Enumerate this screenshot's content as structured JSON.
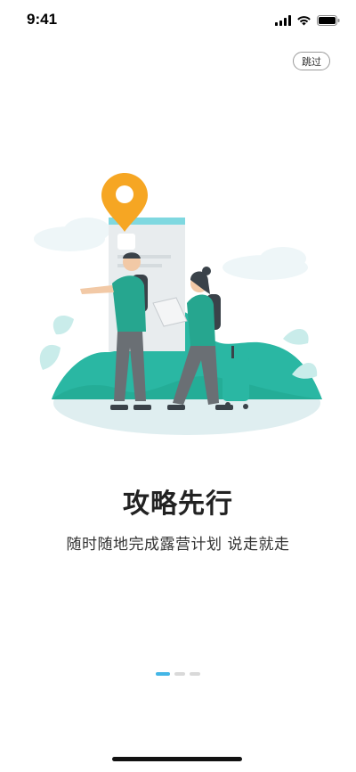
{
  "status_bar": {
    "time": "9:41"
  },
  "header": {
    "skip_label": "跳过"
  },
  "onboarding": {
    "title": "攻略先行",
    "subtitle": "随时随地完成露营计划 说走就走",
    "page_count": 3,
    "active_page": 1
  },
  "colors": {
    "accent_teal": "#24b7a3",
    "pin_orange": "#f6a623",
    "dot_active": "#43b6e6",
    "dot_inactive": "#d9d9d9"
  },
  "icons": {
    "signal": "signal-icon",
    "wifi": "wifi-icon",
    "battery": "battery-icon",
    "location_pin": "location-pin-icon"
  }
}
